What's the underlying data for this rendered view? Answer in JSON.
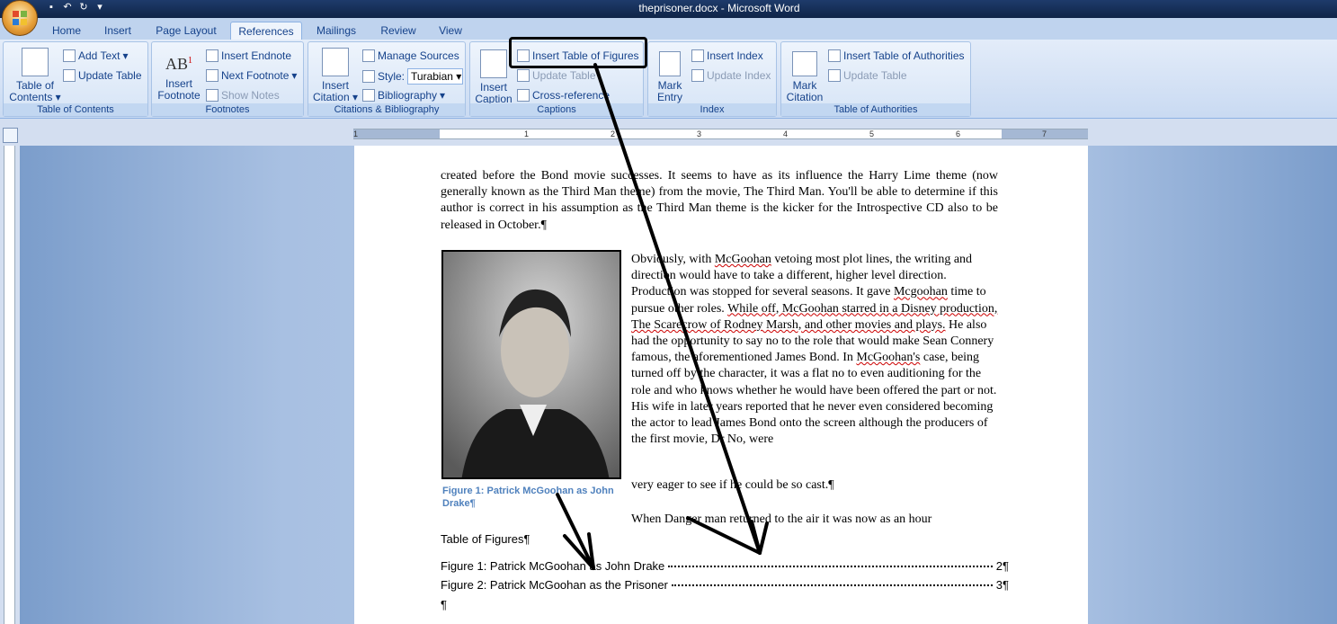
{
  "window": {
    "title": "theprisoner.docx - Microsoft Word"
  },
  "tabs": [
    "Home",
    "Insert",
    "Page Layout",
    "References",
    "Mailings",
    "Review",
    "View"
  ],
  "active_tab": "References",
  "ribbon": {
    "toc": {
      "big": "Table of Contents",
      "add_text": "Add Text",
      "update_table": "Update Table",
      "label": "Table of Contents"
    },
    "footnotes": {
      "big": "Insert Footnote",
      "insert_endnote": "Insert Endnote",
      "next_footnote": "Next Footnote",
      "show_notes": "Show Notes",
      "label": "Footnotes"
    },
    "citations": {
      "big": "Insert Citation",
      "manage_sources": "Manage Sources",
      "style_label": "Style:",
      "style_value": "Turabian",
      "bibliography": "Bibliography",
      "label": "Citations & Bibliography"
    },
    "captions": {
      "big": "Insert Caption",
      "insert_tof": "Insert Table of Figures",
      "update_table": "Update Table",
      "cross_ref": "Cross-reference",
      "label": "Captions"
    },
    "index": {
      "big": "Mark Entry",
      "insert_index": "Insert Index",
      "update_index": "Update Index",
      "label": "Index"
    },
    "authorities": {
      "big": "Mark Citation",
      "insert_toa": "Insert Table of Authorities",
      "update_table": "Update Table",
      "label": "Table of Authorities"
    }
  },
  "ruler": {
    "marks": [
      "1",
      "1",
      "2",
      "3",
      "4",
      "5",
      "6",
      "7"
    ]
  },
  "document": {
    "para1": "created before the Bond movie successes.  It seems to have as its influence the Harry Lime theme (now generally known as the Third Man theme) from the movie, The Third Man.  You'll be able to determine if this author is correct in his assumption as the Third Man theme is the kicker for the Introspective CD also to be released in October.¶",
    "para2_a": "Obviously, with ",
    "para2_b": "McGoohan",
    "para2_c": " vetoing most plot lines, the writing and direction would have to take a different, higher level direction. Production was stopped for several seasons. It gave ",
    "para2_d": "Mcgoohan",
    "para2_e": " time to pursue other roles.  ",
    "para2_f": "While off, McGoohan starred in a Disney production, The Scarecrow of Rodney Marsh, and other movies and plays.",
    "para2_g": " He also had the opportunity to say no to the role that would make Sean Connery famous, the aforementioned James Bond. In ",
    "para2_h": "McGoohan's",
    "para2_i": " case, being turned off by the character, it was a flat no to even auditioning for the role and who knows whether he would have been offered the part or not. His wife in later years reported that he never even considered becoming the actor to lead James Bond onto the screen although the producers of the first movie, Dr No, were",
    "line_cast": "very eager to see if he could be so cast.¶",
    "line_danger": "When Danger man returned to the air it was now as an hour",
    "caption": "Figure 1: Patrick McGoohan as John Drake¶",
    "tof_title": "Table of Figures¶",
    "tof_entries": [
      {
        "text": "Figure 1: Patrick McGoohan as John Drake",
        "page": "2¶"
      },
      {
        "text": "Figure 2: Patrick McGoohan as the Prisoner",
        "page": "3¶"
      }
    ],
    "end_mark": "¶"
  }
}
